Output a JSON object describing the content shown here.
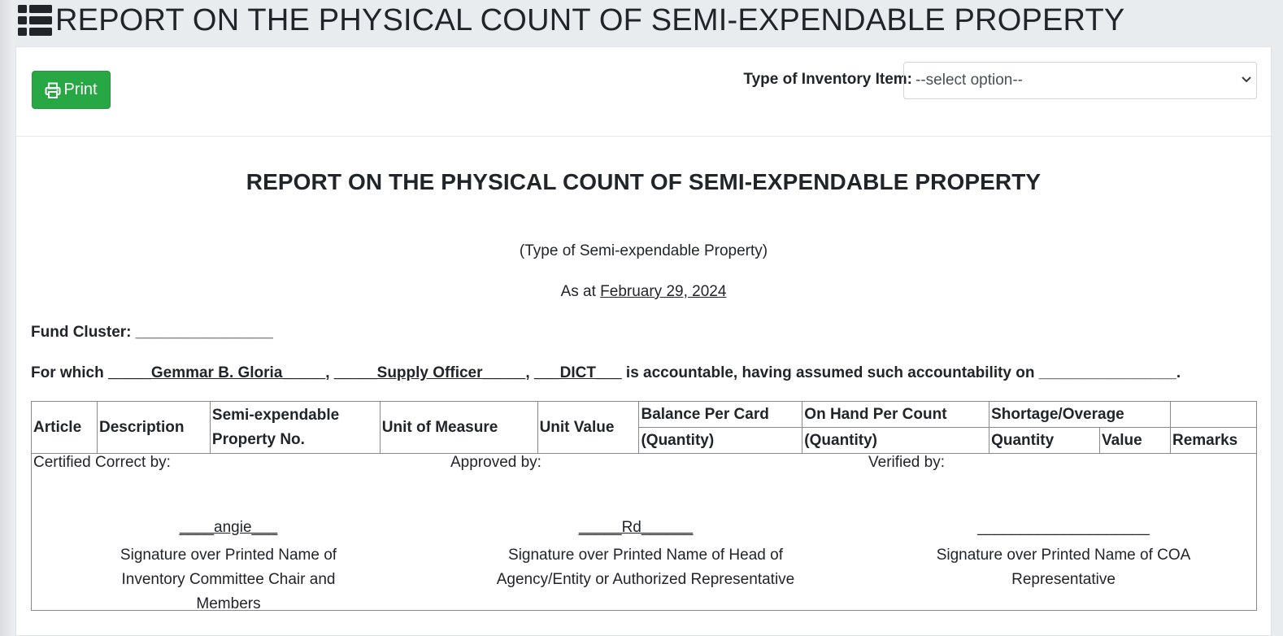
{
  "page": {
    "title": "REPORT ON THE PHYSICAL COUNT OF SEMI-EXPENDABLE PROPERTY",
    "icon": "list-icon"
  },
  "toolbar": {
    "print_label": "Print",
    "type_label": "Type of Inventory Item:",
    "type_select_value": "--select option--"
  },
  "report": {
    "title": "REPORT ON THE PHYSICAL COUNT OF SEMI-EXPENDABLE PROPERTY",
    "subtitle": "(Type of Semi-expendable Property)",
    "as_at_prefix": "As at",
    "as_at_date": "February 29, 2024",
    "fund_cluster_label": "Fund Cluster:",
    "fund_cluster_value": "________________",
    "for_which_prefix": "For which",
    "accountable_name": "_____Gemmar B. Gloria_____",
    "accountable_position": "_____Supply Officer_____",
    "accountable_office": "___DICT___",
    "accountable_suffix": "is accountable, having assumed such accountability on",
    "assumed_date": "________________."
  },
  "table": {
    "headers": {
      "article": "Article",
      "description": "Description",
      "property_no": "Semi-expendable Property No.",
      "unit_of_measure": "Unit of Measure",
      "unit_value": "Unit Value",
      "balance_per_card": "Balance Per Card",
      "balance_sub": "(Quantity)",
      "on_hand_per_count": "On Hand Per Count",
      "on_hand_sub": "(Quantity)",
      "shortage_overage": "Shortage/Overage",
      "quantity": "Quantity",
      "value": "Value",
      "remarks": "Remarks"
    }
  },
  "signatures": {
    "certified": {
      "label": "Certified Correct by:",
      "name": "____angie___",
      "caption": "Signature over Printed Name of Inventory Committee Chair and Members"
    },
    "approved": {
      "label": "Approved by:",
      "name": "_____Rd______",
      "caption": "Signature over Printed Name of Head of Agency/Entity or Authorized Representative"
    },
    "verified": {
      "label": "Verified by:",
      "name": "____________________",
      "caption": "Signature over Printed Name of COA Representative"
    }
  }
}
